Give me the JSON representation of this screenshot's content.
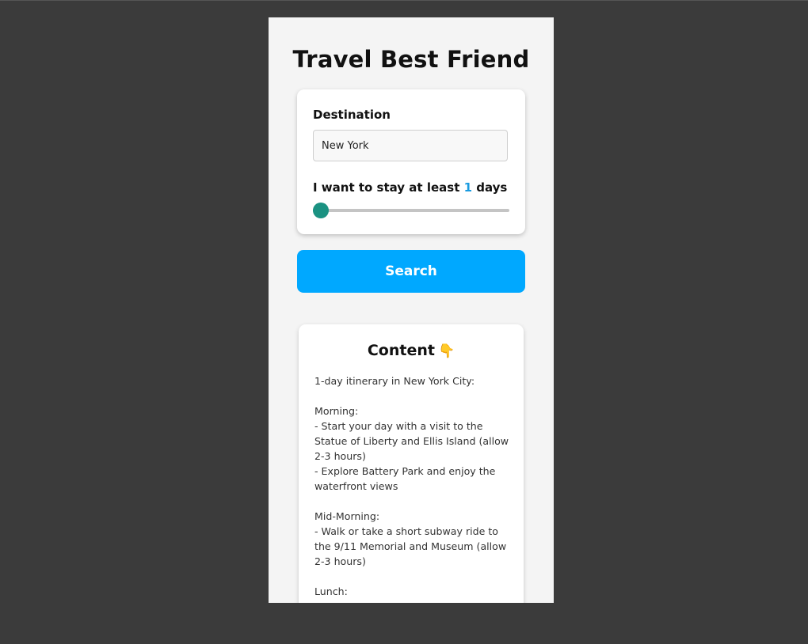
{
  "app": {
    "title": "Travel Best Friend"
  },
  "form": {
    "destination_label": "Destination",
    "destination_value": "New York",
    "stay_label_prefix": "I want to stay at least ",
    "stay_days": "1",
    "stay_label_suffix": " days",
    "stay_slider_fraction": 0
  },
  "search": {
    "label": "Search"
  },
  "content": {
    "title": "Content",
    "title_icon": "pointing-down-icon",
    "text": "1-day itinerary in New York City:\n\nMorning:\n- Start your day with a visit to the Statue of Liberty and Ellis Island (allow 2-3 hours)\n- Explore Battery Park and enjoy the waterfront views\n\nMid-Morning:\n- Walk or take a short subway ride to the 9/11 Memorial and Museum (allow 2-3 hours)\n\nLunch:"
  },
  "colors": {
    "accent": "#00a8ff",
    "slider": "#1b9282",
    "days_highlight": "#1a9be0"
  }
}
